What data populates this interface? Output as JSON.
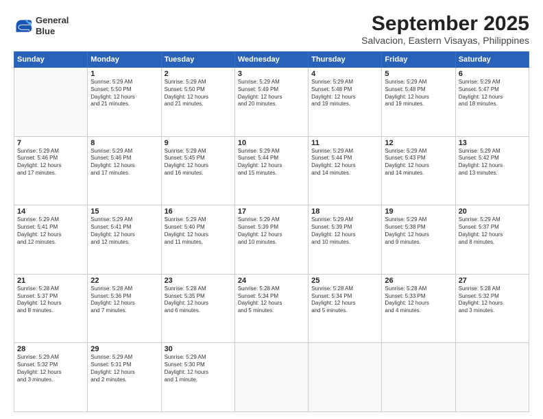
{
  "logo": {
    "line1": "General",
    "line2": "Blue"
  },
  "title": "September 2025",
  "location": "Salvacion, Eastern Visayas, Philippines",
  "days_header": [
    "Sunday",
    "Monday",
    "Tuesday",
    "Wednesday",
    "Thursday",
    "Friday",
    "Saturday"
  ],
  "weeks": [
    [
      {
        "day": "",
        "info": ""
      },
      {
        "day": "1",
        "info": "Sunrise: 5:29 AM\nSunset: 5:50 PM\nDaylight: 12 hours\nand 21 minutes."
      },
      {
        "day": "2",
        "info": "Sunrise: 5:29 AM\nSunset: 5:50 PM\nDaylight: 12 hours\nand 21 minutes."
      },
      {
        "day": "3",
        "info": "Sunrise: 5:29 AM\nSunset: 5:49 PM\nDaylight: 12 hours\nand 20 minutes."
      },
      {
        "day": "4",
        "info": "Sunrise: 5:29 AM\nSunset: 5:48 PM\nDaylight: 12 hours\nand 19 minutes."
      },
      {
        "day": "5",
        "info": "Sunrise: 5:29 AM\nSunset: 5:48 PM\nDaylight: 12 hours\nand 19 minutes."
      },
      {
        "day": "6",
        "info": "Sunrise: 5:29 AM\nSunset: 5:47 PM\nDaylight: 12 hours\nand 18 minutes."
      }
    ],
    [
      {
        "day": "7",
        "info": "Sunrise: 5:29 AM\nSunset: 5:46 PM\nDaylight: 12 hours\nand 17 minutes."
      },
      {
        "day": "8",
        "info": "Sunrise: 5:29 AM\nSunset: 5:46 PM\nDaylight: 12 hours\nand 17 minutes."
      },
      {
        "day": "9",
        "info": "Sunrise: 5:29 AM\nSunset: 5:45 PM\nDaylight: 12 hours\nand 16 minutes."
      },
      {
        "day": "10",
        "info": "Sunrise: 5:29 AM\nSunset: 5:44 PM\nDaylight: 12 hours\nand 15 minutes."
      },
      {
        "day": "11",
        "info": "Sunrise: 5:29 AM\nSunset: 5:44 PM\nDaylight: 12 hours\nand 14 minutes."
      },
      {
        "day": "12",
        "info": "Sunrise: 5:29 AM\nSunset: 5:43 PM\nDaylight: 12 hours\nand 14 minutes."
      },
      {
        "day": "13",
        "info": "Sunrise: 5:29 AM\nSunset: 5:42 PM\nDaylight: 12 hours\nand 13 minutes."
      }
    ],
    [
      {
        "day": "14",
        "info": "Sunrise: 5:29 AM\nSunset: 5:41 PM\nDaylight: 12 hours\nand 12 minutes."
      },
      {
        "day": "15",
        "info": "Sunrise: 5:29 AM\nSunset: 5:41 PM\nDaylight: 12 hours\nand 12 minutes."
      },
      {
        "day": "16",
        "info": "Sunrise: 5:29 AM\nSunset: 5:40 PM\nDaylight: 12 hours\nand 11 minutes."
      },
      {
        "day": "17",
        "info": "Sunrise: 5:29 AM\nSunset: 5:39 PM\nDaylight: 12 hours\nand 10 minutes."
      },
      {
        "day": "18",
        "info": "Sunrise: 5:29 AM\nSunset: 5:39 PM\nDaylight: 12 hours\nand 10 minutes."
      },
      {
        "day": "19",
        "info": "Sunrise: 5:29 AM\nSunset: 5:38 PM\nDaylight: 12 hours\nand 9 minutes."
      },
      {
        "day": "20",
        "info": "Sunrise: 5:29 AM\nSunset: 5:37 PM\nDaylight: 12 hours\nand 8 minutes."
      }
    ],
    [
      {
        "day": "21",
        "info": "Sunrise: 5:28 AM\nSunset: 5:37 PM\nDaylight: 12 hours\nand 8 minutes."
      },
      {
        "day": "22",
        "info": "Sunrise: 5:28 AM\nSunset: 5:36 PM\nDaylight: 12 hours\nand 7 minutes."
      },
      {
        "day": "23",
        "info": "Sunrise: 5:28 AM\nSunset: 5:35 PM\nDaylight: 12 hours\nand 6 minutes."
      },
      {
        "day": "24",
        "info": "Sunrise: 5:28 AM\nSunset: 5:34 PM\nDaylight: 12 hours\nand 5 minutes."
      },
      {
        "day": "25",
        "info": "Sunrise: 5:28 AM\nSunset: 5:34 PM\nDaylight: 12 hours\nand 5 minutes."
      },
      {
        "day": "26",
        "info": "Sunrise: 5:28 AM\nSunset: 5:33 PM\nDaylight: 12 hours\nand 4 minutes."
      },
      {
        "day": "27",
        "info": "Sunrise: 5:28 AM\nSunset: 5:32 PM\nDaylight: 12 hours\nand 3 minutes."
      }
    ],
    [
      {
        "day": "28",
        "info": "Sunrise: 5:29 AM\nSunset: 5:32 PM\nDaylight: 12 hours\nand 3 minutes."
      },
      {
        "day": "29",
        "info": "Sunrise: 5:29 AM\nSunset: 5:31 PM\nDaylight: 12 hours\nand 2 minutes."
      },
      {
        "day": "30",
        "info": "Sunrise: 5:29 AM\nSunset: 5:30 PM\nDaylight: 12 hours\nand 1 minute."
      },
      {
        "day": "",
        "info": ""
      },
      {
        "day": "",
        "info": ""
      },
      {
        "day": "",
        "info": ""
      },
      {
        "day": "",
        "info": ""
      }
    ]
  ]
}
